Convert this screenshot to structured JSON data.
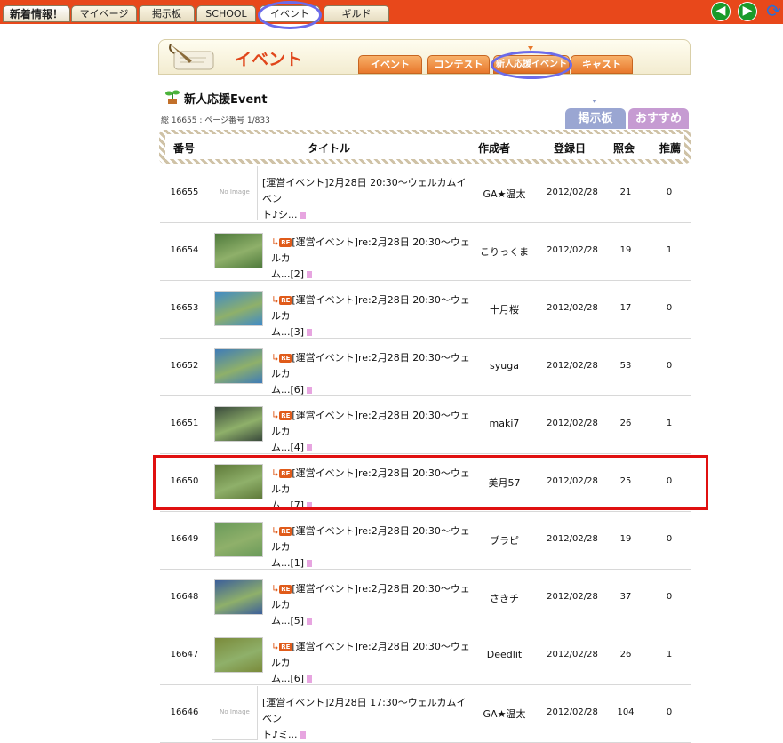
{
  "top_tabs": [
    {
      "label": "新着情報！"
    },
    {
      "label": "マイページ"
    },
    {
      "label": "掲示板"
    },
    {
      "label": "SCHOOL"
    },
    {
      "label": "イベント"
    },
    {
      "label": "ギルド"
    }
  ],
  "nav_icons": [
    "back-arrow-icon",
    "forward-arrow-icon",
    "refresh-icon"
  ],
  "banner": {
    "title": "イベント",
    "tabs": [
      {
        "label": "イベント"
      },
      {
        "label": "コンテスト"
      },
      {
        "label": "新人応援イベント"
      },
      {
        "label": "キャスト"
      }
    ]
  },
  "board": {
    "title": "新人応援Event",
    "meta": "総 16655 : ページ番号 1/833",
    "view_tabs": [
      {
        "label": "掲示板",
        "color": "#9aa6d2"
      },
      {
        "label": "おすすめ",
        "color": "#c69bd2"
      }
    ]
  },
  "table": {
    "headers": [
      "番号",
      "タイトル",
      "作成者",
      "登録日",
      "照会",
      "推薦"
    ],
    "rows": [
      {
        "num": "16655",
        "thumb": "No Image",
        "line1": "[運営イベント]2月28日 20:30〜ウェルカムイベン",
        "line2": "ト♪シ...",
        "author": "GA★温太",
        "date": "2012/02/28",
        "views": "21",
        "rec": "0",
        "reply": false,
        "thumb_color": ""
      },
      {
        "num": "16654",
        "thumb": "",
        "line1": "[運営イベント]re:2月28日 20:30〜ウェルカ",
        "line2": "ム...[2]",
        "author": "こりっくま",
        "date": "2012/02/28",
        "views": "19",
        "rec": "1",
        "reply": true,
        "thumb_color": "#4f7a3c"
      },
      {
        "num": "16653",
        "thumb": "",
        "line1": "[運営イベント]re:2月28日 20:30〜ウェルカ",
        "line2": "ム...[3]",
        "author": "十月桜",
        "date": "2012/02/28",
        "views": "17",
        "rec": "0",
        "reply": true,
        "thumb_color": "#3f8ac8"
      },
      {
        "num": "16652",
        "thumb": "",
        "line1": "[運営イベント]re:2月28日 20:30〜ウェルカ",
        "line2": "ム...[6]",
        "author": "syuga",
        "date": "2012/02/28",
        "views": "53",
        "rec": "0",
        "reply": true,
        "thumb_color": "#3f7cb8"
      },
      {
        "num": "16651",
        "thumb": "",
        "line1": "[運営イベント]re:2月28日 20:30〜ウェルカ",
        "line2": "ム...[4]",
        "author": "maki7",
        "date": "2012/02/28",
        "views": "26",
        "rec": "1",
        "reply": true,
        "thumb_color": "#3a4a3c"
      },
      {
        "num": "16650",
        "thumb": "",
        "line1": "[運営イベント]re:2月28日 20:30〜ウェルカ",
        "line2": "ム...[7]",
        "author": "美月57",
        "date": "2012/02/28",
        "views": "25",
        "rec": "0",
        "reply": true,
        "thumb_color": "#5f7a3a"
      },
      {
        "num": "16649",
        "thumb": "",
        "line1": "[運営イベント]re:2月28日 20:30〜ウェルカ",
        "line2": "ム...[1]",
        "author": "ブラピ",
        "date": "2012/02/28",
        "views": "19",
        "rec": "0",
        "reply": true,
        "thumb_color": "#6a9a5a"
      },
      {
        "num": "16648",
        "thumb": "",
        "line1": "[運営イベント]re:2月28日 20:30〜ウェルカ",
        "line2": "ム...[5]",
        "author": "さきチ",
        "date": "2012/02/28",
        "views": "37",
        "rec": "0",
        "reply": true,
        "thumb_color": "#3c5f9a"
      },
      {
        "num": "16647",
        "thumb": "",
        "line1": "[運営イベント]re:2月28日 20:30〜ウェルカ",
        "line2": "ム...[6]",
        "author": "Deedlit",
        "date": "2012/02/28",
        "views": "26",
        "rec": "1",
        "reply": true,
        "thumb_color": "#7a8a3a"
      },
      {
        "num": "16646",
        "thumb": "No Image",
        "line1": "[運営イベント]2月28日 17:30〜ウェルカムイベン",
        "line2": "ト♪ミ...",
        "author": "GA★温太",
        "date": "2012/02/28",
        "views": "104",
        "rec": "0",
        "reply": false,
        "thumb_color": ""
      }
    ],
    "re_badge": "RE",
    "reply_arrow": "↳"
  },
  "colors": {
    "topbar": "#e8481b",
    "accent_orange": "#e8782c",
    "highlight_box": "#e01010",
    "circle_annotation": "#6b6bea"
  }
}
